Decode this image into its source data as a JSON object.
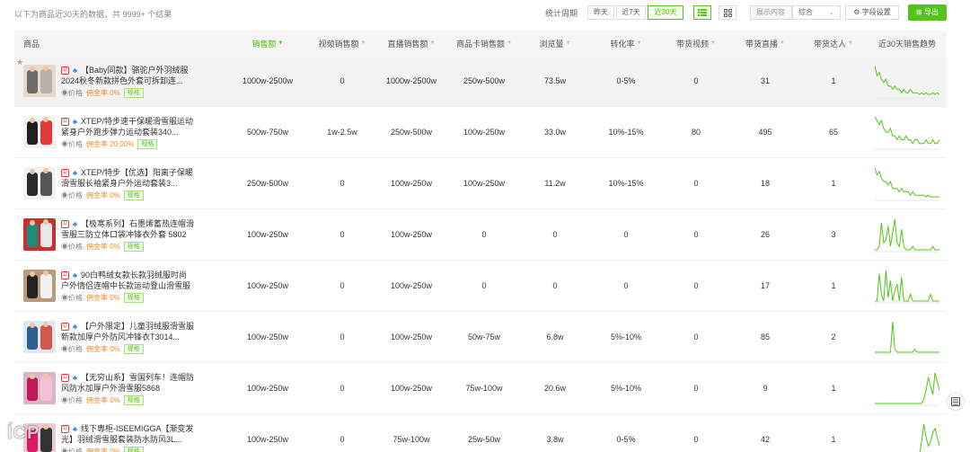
{
  "summary_text": "以下为商品近30天的数据，共 9999+ 个结果",
  "period": {
    "label": "统计周期",
    "options": [
      "昨天",
      "近7天",
      "近30天"
    ],
    "active": 2
  },
  "display_select": {
    "label": "展示内容",
    "value": "综合"
  },
  "field_settings_label": "字段设置",
  "export_label": "导出",
  "columns": [
    "商品",
    "销售额",
    "视频销售额",
    "直播销售额",
    "商品卡销售额",
    "浏览量",
    "转化率",
    "带货视频",
    "带货直播",
    "带货达人",
    "近30天销售趋势"
  ],
  "meta_labels": {
    "price": "价格",
    "commission_prefix": "佣金率",
    "spec": "规格"
  },
  "accent_color": "#52c41a",
  "rows": [
    {
      "title": "【Baby同款】骆驼户外羽绒服2024秋冬新款拼色外套可拆卸连...",
      "commission": "0%",
      "sales": "1000w-2500w",
      "video_sales": "0",
      "live_sales": "1000w-2500w",
      "card_sales": "250w-500w",
      "views": "73.5w",
      "conversion": "0-5%",
      "videos": "0",
      "lives": "31",
      "creators": "1",
      "trend": [
        9,
        6,
        7,
        5,
        4,
        5,
        3,
        3,
        2,
        3,
        2,
        2,
        1,
        2,
        1,
        1,
        2,
        1,
        1,
        1,
        0.5,
        1,
        0.5,
        1,
        0.5,
        0.5,
        1,
        0.5,
        1,
        0.5
      ]
    },
    {
      "title": "XTEP/特步速干保暖滑雪服运动紧身户外跑步弹力运动套装340...",
      "commission": "20.00%",
      "sales": "500w-750w",
      "video_sales": "1w-2.5w",
      "live_sales": "250w-500w",
      "card_sales": "100w-250w",
      "views": "33.0w",
      "conversion": "10%-15%",
      "videos": "80",
      "lives": "495",
      "creators": "65",
      "trend": [
        8,
        7,
        6,
        7,
        5,
        4,
        4,
        5,
        3,
        3,
        2,
        3,
        2,
        2,
        3,
        2,
        2,
        1,
        2,
        2,
        1,
        1,
        1,
        2,
        1,
        1,
        2,
        1,
        1,
        2
      ]
    },
    {
      "title": "XTEP/特步【优选】阳离子保暖滑雪服长袖紧身户外运动套装3...",
      "commission": "0%",
      "sales": "250w-500w",
      "video_sales": "0",
      "live_sales": "100w-250w",
      "card_sales": "100w-250w",
      "views": "11.2w",
      "conversion": "10%-15%",
      "videos": "0",
      "lives": "18",
      "creators": "1",
      "trend": [
        9,
        7,
        8,
        6,
        5,
        5,
        4,
        5,
        3,
        3,
        3,
        2,
        3,
        2,
        2,
        2,
        1,
        2,
        1,
        1,
        1,
        1,
        1,
        0.5,
        1,
        0.5,
        0.5,
        0.5,
        0.5,
        0.5
      ]
    },
    {
      "title": "【极寒系列】石墨烯蓄热连帽滑雪服三防立体口袋冲锋衣外套 5802",
      "commission": "0%",
      "sales": "100w-250w",
      "video_sales": "0",
      "live_sales": "100w-250w",
      "card_sales": "0",
      "views": "0",
      "conversion": "0",
      "videos": "0",
      "lives": "26",
      "creators": "3",
      "trend": [
        0,
        0,
        1,
        8,
        2,
        3,
        7,
        1,
        5,
        9,
        2,
        1,
        6,
        1,
        0,
        0,
        0,
        1,
        0,
        0,
        0,
        0,
        0,
        0,
        0,
        0,
        1,
        0,
        0,
        0
      ]
    },
    {
      "title": "90白鸭绒女款长款羽绒服时尚户外情侣连帽中长款运动登山滑雪服",
      "commission": "0%",
      "sales": "100w-250w",
      "video_sales": "0",
      "live_sales": "100w-250w",
      "card_sales": "0",
      "views": "0",
      "conversion": "0",
      "videos": "0",
      "lives": "17",
      "creators": "1",
      "trend": [
        0,
        0,
        8,
        2,
        0,
        9,
        1,
        6,
        0,
        3,
        5,
        0,
        7,
        0,
        0,
        0,
        2,
        0,
        0,
        0,
        0,
        0,
        0,
        0,
        0,
        2,
        0,
        0,
        0,
        0
      ]
    },
    {
      "title": "【户外限定】儿童羽绒服滑雪服新款加厚户外防风冲锋衣T3014...",
      "commission": "0%",
      "sales": "100w-250w",
      "video_sales": "0",
      "live_sales": "100w-250w",
      "card_sales": "50w-75w",
      "views": "6.8w",
      "conversion": "5%-10%",
      "videos": "0",
      "lives": "85",
      "creators": "2",
      "trend": [
        0,
        0,
        0,
        0,
        0,
        0,
        0,
        0,
        10,
        1,
        0,
        0,
        0,
        0,
        0,
        0,
        0,
        0,
        1,
        0,
        0,
        0,
        0,
        0,
        0,
        0,
        0,
        0,
        0,
        0
      ]
    },
    {
      "title": "【无穷山系】雪国列车！连帽防风防水加厚户外滑雪服5868",
      "commission": "0%",
      "sales": "100w-250w",
      "video_sales": "0",
      "live_sales": "100w-250w",
      "card_sales": "75w-100w",
      "views": "20.6w",
      "conversion": "5%-10%",
      "videos": "0",
      "lives": "9",
      "creators": "1",
      "trend": [
        0,
        0,
        0,
        0,
        0,
        0,
        0,
        0,
        0,
        0,
        0,
        0,
        0,
        0,
        0,
        0,
        0,
        0,
        0,
        0,
        0,
        0,
        1,
        3,
        6,
        4,
        2,
        7,
        5,
        3
      ]
    },
    {
      "title": "线下専柜-ISEEMIGGA【渐变发光】羽绒滑雪服套装防水防风3L...",
      "commission": "0%",
      "sales": "100w-250w",
      "video_sales": "0",
      "live_sales": "75w-100w",
      "card_sales": "25w-50w",
      "views": "3.8w",
      "conversion": "0-5%",
      "videos": "0",
      "lives": "42",
      "creators": "1",
      "trend": [
        0,
        0,
        0,
        0,
        0,
        0,
        0,
        0,
        0,
        0,
        0,
        0,
        0,
        0,
        0,
        0,
        0,
        0,
        0,
        0,
        0,
        3,
        7,
        4,
        2,
        3,
        5,
        6,
        4,
        2
      ]
    }
  ]
}
